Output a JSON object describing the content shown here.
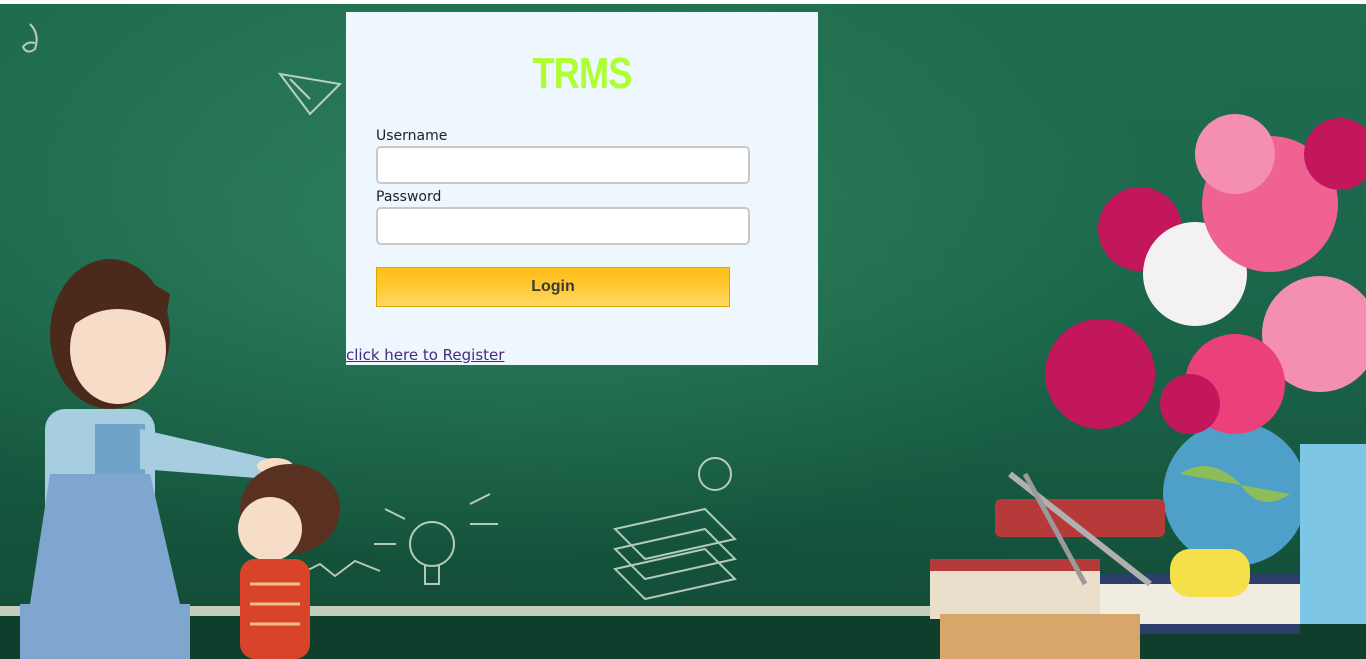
{
  "app": {
    "title": "TRMS"
  },
  "login_form": {
    "username_label": "Username",
    "username_value": "",
    "password_label": "Password",
    "password_value": "",
    "login_button": "Login",
    "register_link": "click here to Register"
  },
  "colors": {
    "title": "#adff2f",
    "card_background": "#eef6fe",
    "button": "#ffc933",
    "chalkboard": "#1a6247",
    "link": "#4a2a7a"
  }
}
